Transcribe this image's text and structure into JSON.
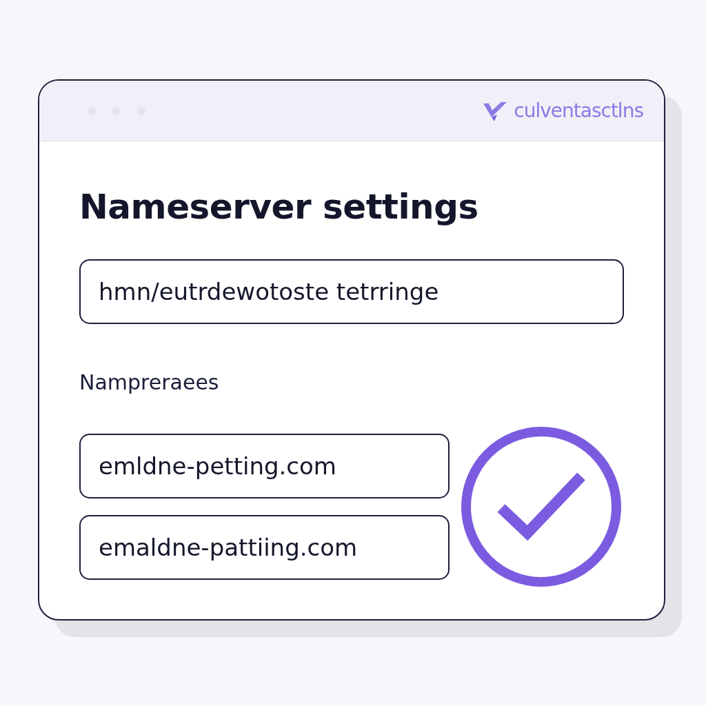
{
  "title_bar": {
    "brand": "culventasctlns"
  },
  "heading": "Nameserver settings",
  "main_field": {
    "value": "hmn/eutrdewotoste tetrringe"
  },
  "section_label": "Nampreraees",
  "nameservers": [
    {
      "value": "emldne-petting.com"
    },
    {
      "value": "emaldne-pattiing.com"
    }
  ],
  "status": {
    "verified": true
  }
}
